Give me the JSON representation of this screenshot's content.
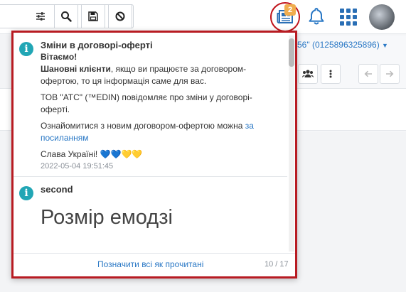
{
  "header": {
    "news_badge_count": "2",
    "icons": {
      "filter": "sliders-icon",
      "search": "search-icon",
      "save": "floppy-disk-icon",
      "clear": "ban-icon",
      "news": "newspaper-icon",
      "notifications": "bell-icon",
      "apps": "grid-icon"
    }
  },
  "background": {
    "account_text": "56\" (0125896325896)"
  },
  "popup": {
    "notes": [
      {
        "title": "Зміни в договорі-оферті",
        "greeting": "Вітаємо!",
        "lead_bold": "Шановні клієнти",
        "lead_rest": ", якщо ви працюєте за договором-офертою, то ця інформація саме для вас.",
        "para2": "ТОВ \"АТС\" (™EDIN) повідомляє про зміни у договорі-оферті.",
        "para3_text": "Ознайомитися з новим договором-офертою можна ",
        "para3_link": "за посиланням",
        "para4": "Слава Україні! 💙💙💛💛",
        "date": "2022-05-04 19:51:45"
      },
      {
        "title": "second",
        "heading": "Розмір емодзі"
      }
    ],
    "mark_all_read": "Позначити всі як прочитані",
    "pager": "10 / 17"
  },
  "colors": {
    "accent_red": "#b81b22",
    "link_blue": "#2a78c5",
    "info_teal": "#21a6b5",
    "badge_orange": "#f0ad4e"
  }
}
